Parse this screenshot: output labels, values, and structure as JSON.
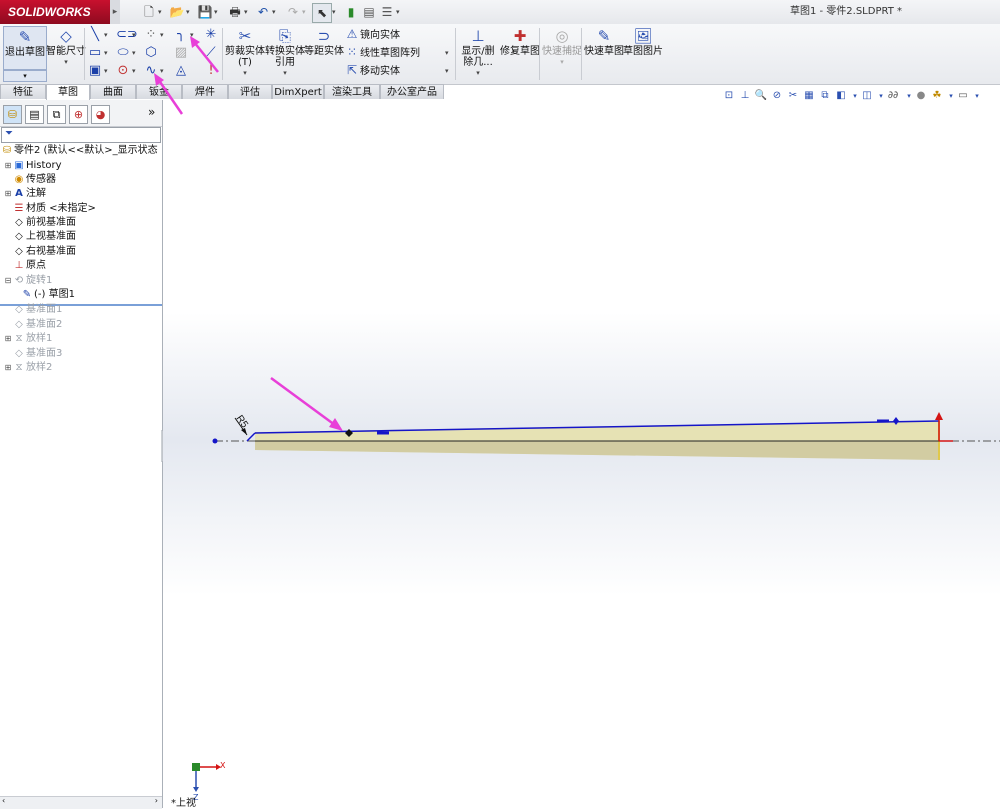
{
  "titlebar": {
    "app_name": "SOLIDWORKS",
    "document_title": "草图1 - 零件2.SLDPRT *"
  },
  "ribbon": {
    "exit_sketch": "退出草图",
    "smart_dimension": "智能尺寸",
    "trim_entities": "剪裁实体(T)",
    "convert_entities": "转换实体引用",
    "offset_entities": "等距实体",
    "mirror_entities": "镜向实体",
    "linear_pattern": "线性草图阵列",
    "move_entities": "移动实体",
    "display_delete_relations": "显示/删除几...",
    "repair_sketch": "修复草图",
    "quick_snaps": "快速捕捉",
    "rapid_sketch": "快速草图",
    "sketch_picture": "草图图片"
  },
  "tabs": [
    "特征",
    "草图",
    "曲面",
    "钣金",
    "焊件",
    "评估",
    "DimXpert",
    "渲染工具",
    "办公室产品"
  ],
  "active_tab": "草图",
  "tree": {
    "root": "零件2 (默认<<默认>_显示状态",
    "items": [
      {
        "label": "History",
        "icon": "history-icon"
      },
      {
        "label": "传感器",
        "icon": "sensor-icon"
      },
      {
        "label": "注解",
        "icon": "annotation-icon"
      },
      {
        "label": "材质 <未指定>",
        "icon": "material-icon"
      },
      {
        "label": "前视基准面",
        "icon": "plane-icon"
      },
      {
        "label": "上视基准面",
        "icon": "plane-icon"
      },
      {
        "label": "右视基准面",
        "icon": "plane-icon"
      },
      {
        "label": "原点",
        "icon": "origin-icon"
      },
      {
        "label": "旋转1",
        "icon": "revolve-icon"
      },
      {
        "label": "(-) 草图1",
        "icon": "sketch-icon"
      },
      {
        "label": "基准面1",
        "icon": "plane-icon"
      },
      {
        "label": "基准面2",
        "icon": "plane-icon"
      },
      {
        "label": "放样1",
        "icon": "loft-icon"
      },
      {
        "label": "基准面3",
        "icon": "plane-icon"
      },
      {
        "label": "放样2",
        "icon": "loft-icon"
      }
    ]
  },
  "viewport": {
    "dimension_label": "R5",
    "triad_x": "X",
    "triad_z": "Z",
    "view_name": "*上视"
  },
  "colors": {
    "sketch_line": "#1515c8",
    "part_fill": "#e6e2b4",
    "arrow_annotation": "#e83fd8",
    "origin_red": "#d41414"
  }
}
